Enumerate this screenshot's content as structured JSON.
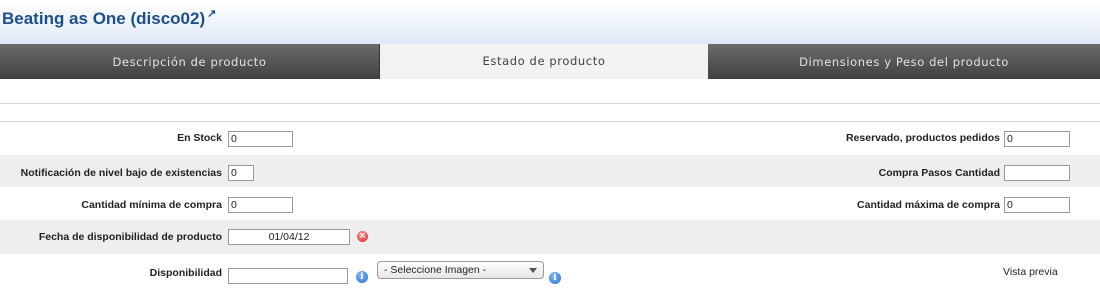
{
  "product": {
    "title": "Beating as One (disco02)",
    "ext_icon": "external-link-icon"
  },
  "tabs": [
    {
      "label": "Descripción de producto"
    },
    {
      "label": "Estado de producto"
    },
    {
      "label": "Dimensiones y Peso del producto"
    }
  ],
  "fields": {
    "en_stock": {
      "label": "En Stock",
      "value": "0"
    },
    "reservado": {
      "label": "Reservado, productos pedidos",
      "value": "0"
    },
    "notificacion": {
      "label": "Notificación de nivel bajo de existencias",
      "value": "0"
    },
    "compra_pasos": {
      "label": "Compra Pasos Cantidad",
      "value": ""
    },
    "cantidad_minima": {
      "label": "Cantidad mínima de compra",
      "value": "0"
    },
    "cantidad_maxima": {
      "label": "Cantidad máxima de compra",
      "value": "0"
    },
    "fecha": {
      "label": "Fecha de disponibilidad de producto",
      "value": "01/04/12"
    },
    "disponibilidad": {
      "label": "Disponibilidad",
      "value": ""
    }
  },
  "imagen_select": {
    "selected": "- Seleccione Imagen -"
  },
  "preview": {
    "label": "Vista previa"
  },
  "icons": {
    "clear": "clear-date-icon",
    "info": "info-icon"
  }
}
